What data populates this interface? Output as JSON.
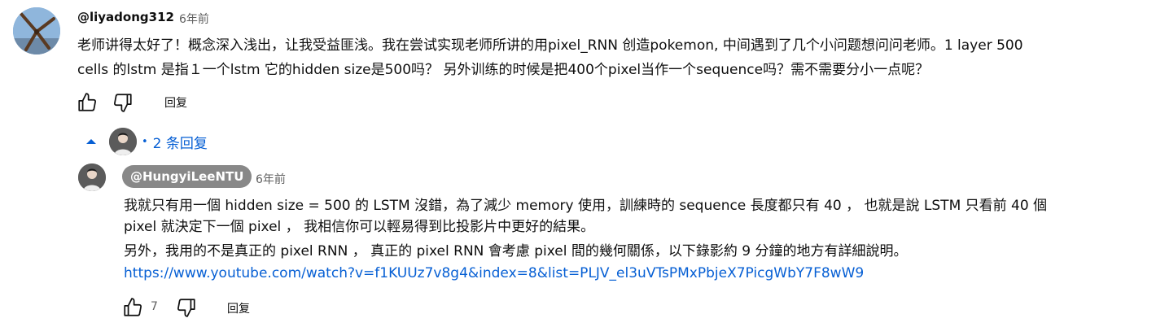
{
  "comment": {
    "author": "@liyadong312",
    "time": "6年前",
    "text_line1": "老师讲得太好了！概念深入浅出，让我受益匪浅。我在尝试实现老师所讲的用pixel_RNN 创造pokemon, 中间遇到了几个小问题想问问老师。1 layer 500",
    "text_line2": "cells 的lstm 是指１一个lstm 它的hidden size是500吗？ 另外训练的时候是把400个pixel当作一个sequence吗？需不需要分小一点呢？",
    "reply_label": "回复",
    "avatar_icon": "windmill-avatar"
  },
  "replies_toggle": {
    "bullet": "•",
    "label": "2 条回复",
    "icon": "chevron-up-icon"
  },
  "reply": {
    "author": "@HungyiLeeNTU",
    "time": "6年前",
    "line1": "我就只有用一個  hidden size = 500 的 LSTM 沒錯，為了減少 memory 使用，訓練時的 sequence 長度都只有 40 ， 也就是說 LSTM 只看前 40 個",
    "line2": "pixel 就決定下一個 pixel ， 我相信你可以輕易得到比投影片中更好的結果。",
    "line3": "另外，我用的不是真正的 pixel RNN ， 真正的 pixel RNN 會考慮 pixel 間的幾何關係，以下錄影約 9 分鐘的地方有詳細說明。",
    "link": "https://www.youtube.com/watch?v=f1KUUz7v8g4&index=8&list=PLJV_el3uVTsPMxPbjeX7PicgWbY7F8wW9",
    "like_count": "7",
    "reply_label": "回复"
  },
  "colors": {
    "link": "#065fd4",
    "chip_bg": "#888888",
    "text": "#0f0f0f",
    "muted": "#606060"
  }
}
